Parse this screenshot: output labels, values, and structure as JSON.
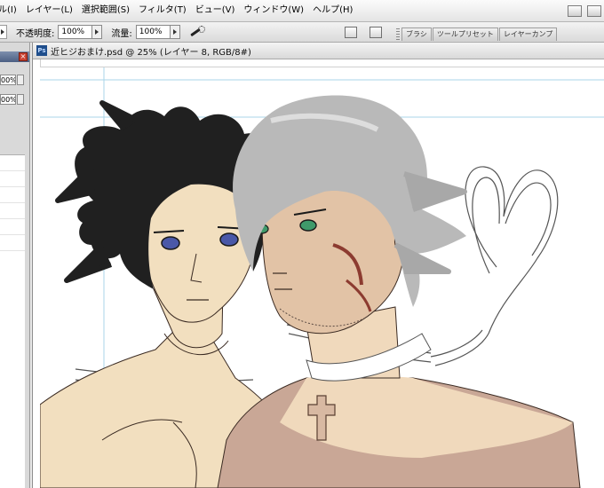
{
  "menubar": {
    "items": [
      "ル(I)",
      "レイヤー(L)",
      "選択範囲(S)",
      "フィルタ(T)",
      "ビュー(V)",
      "ウィンドウ(W)",
      "ヘルプ(H)"
    ]
  },
  "options_bar": {
    "opacity_label": "不透明度:",
    "opacity_value": "100%",
    "flow_label": "流量:",
    "flow_value": "100%",
    "panel_tabs": [
      "ブラシ",
      "ツールプリセット",
      "レイヤーカンプ"
    ]
  },
  "left_panel": {
    "field_1": "00%",
    "field_2": "00%"
  },
  "document": {
    "title": "近ヒジおまけ.psd @ 25% (レイヤー 8, RGB/8#)",
    "icon_label": "Ps"
  },
  "icons": {
    "close": "close-icon",
    "airbrush": "airbrush-icon",
    "document": "psd-document-icon"
  },
  "colors": {
    "skin": "#f2dfbf",
    "skin_shadow": "#c9a796",
    "hair_black": "#202020",
    "hair_silver": "#b9b9b9",
    "eye_blue": "#4a58a8",
    "eye_green": "#3f9a6a",
    "scar": "#8c3b30",
    "guides": "#9fd0e6"
  }
}
